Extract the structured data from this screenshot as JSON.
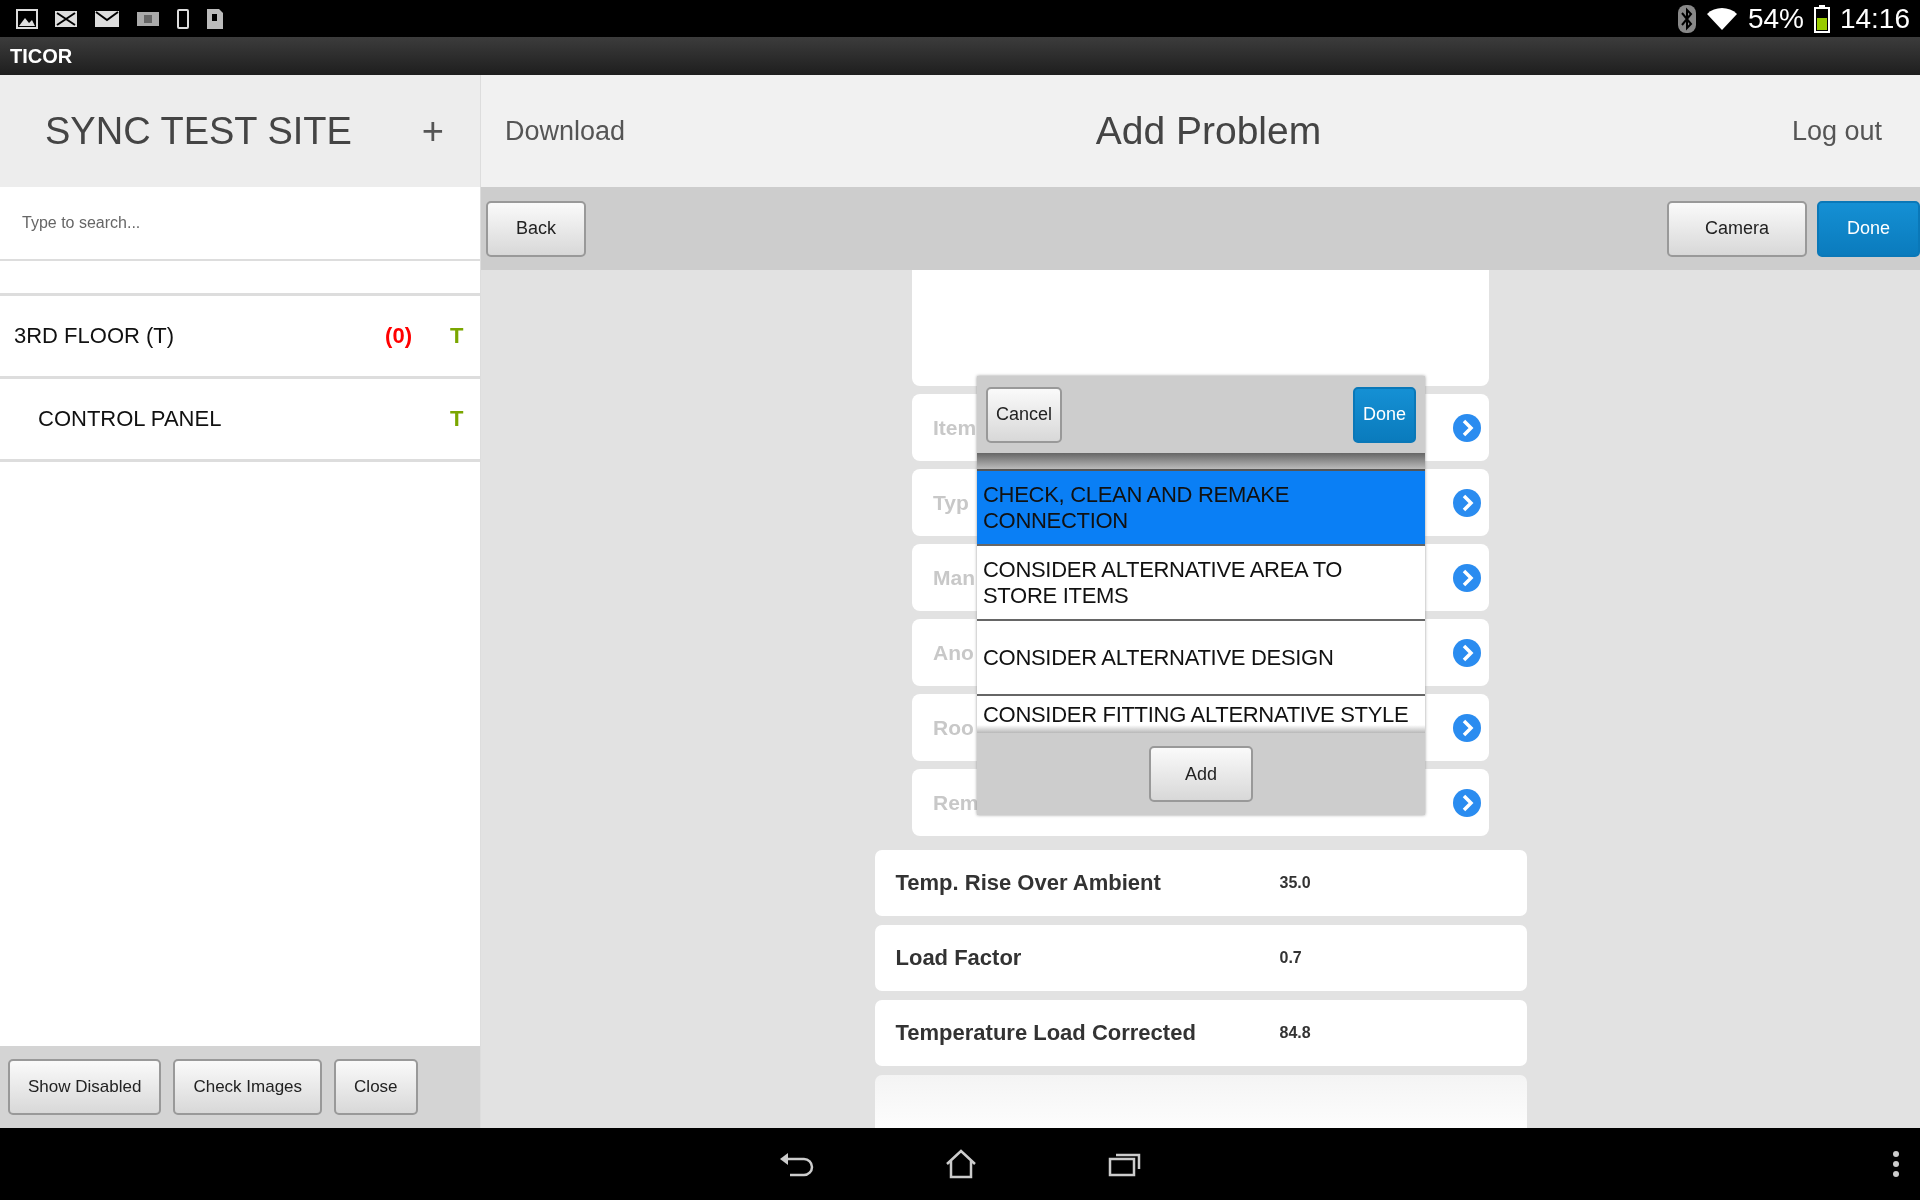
{
  "status_bar": {
    "battery": "54%",
    "time": "14:16"
  },
  "app_bar": {
    "title": "TICOR"
  },
  "sidebar": {
    "title": "SYNC TEST SITE",
    "add": "+",
    "search": {
      "placeholder": "Type to search..."
    },
    "tree": [
      {
        "label": "3RD FLOOR (T)",
        "count": "(0)",
        "flag": "T",
        "children": [
          {
            "label": "CONTROL PANEL",
            "flag": "T"
          }
        ]
      }
    ],
    "buttons": [
      "Show Disabled",
      "Check Images",
      "Close"
    ]
  },
  "header": {
    "left": "Download",
    "title": "Add Problem",
    "right": "Log out"
  },
  "toolbar": {
    "back": "Back",
    "buttons": [
      {
        "label": "Camera",
        "primary": false
      },
      {
        "label": "Done",
        "primary": true
      }
    ]
  },
  "form": {
    "fields": [
      "Item",
      "Typ",
      "Man",
      "Ano",
      "Roo",
      "Rem"
    ],
    "values": [
      {
        "label": "Temp. Rise Over Ambient",
        "value": "35.0"
      },
      {
        "label": "Load Factor",
        "value": "0.7"
      },
      {
        "label": "Temperature Load Corrected",
        "value": "84.8"
      }
    ]
  },
  "picker": {
    "cancel": "Cancel",
    "done": "Done",
    "add": "Add",
    "options": [
      {
        "label": "CHECK, CLEAN AND REMAKE CONNECTION",
        "selected": true
      },
      {
        "label": "CONSIDER ALTERNATIVE AREA TO STORE ITEMS",
        "selected": false
      },
      {
        "label": "CONSIDER ALTERNATIVE DESIGN",
        "selected": false
      },
      {
        "label": "CONSIDER FITTING ALTERNATIVE STYLE",
        "selected": false
      }
    ]
  }
}
